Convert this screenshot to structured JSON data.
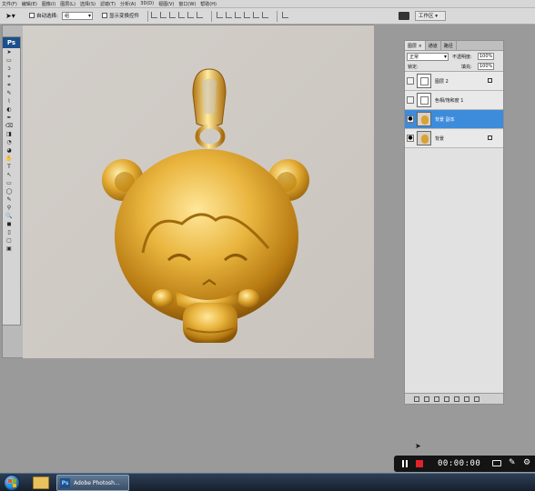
{
  "menubar": {
    "items": [
      "文件(F)",
      "编辑(E)",
      "图像(I)",
      "图层(L)",
      "选择(S)",
      "滤镜(T)",
      "分析(A)",
      "3D(D)",
      "视图(V)",
      "窗口(W)",
      "帮助(H)"
    ]
  },
  "options": {
    "auto_select_label": "自动选择:",
    "auto_select_value": "组",
    "show_transform_label": "显示变换控件",
    "workspace_label": "工作区 ▾"
  },
  "tools": {
    "logo": "Ps"
  },
  "layers": {
    "tabs": [
      "图层 ×",
      "通道",
      "路径"
    ],
    "blend_mode": "正常",
    "opacity_label": "不透明度:",
    "opacity_value": "100%",
    "lock_label": "锁定:",
    "fill_label": "填充:",
    "fill_value": "100%",
    "items": [
      {
        "name": "图层 2",
        "visible": false,
        "locked": true,
        "selected": false,
        "thumb": "layer"
      },
      {
        "name": "色相/饱和度 1",
        "visible": false,
        "locked": false,
        "selected": false,
        "thumb": "adjustment"
      },
      {
        "name": "背景 副本",
        "visible": true,
        "locked": false,
        "selected": true,
        "thumb": "image"
      },
      {
        "name": "背景",
        "visible": true,
        "locked": true,
        "selected": false,
        "thumb": "image"
      }
    ]
  },
  "recorder": {
    "time": "00:00:00"
  },
  "taskbar": {
    "ps_label": "Adobe Photosh..."
  },
  "colors": {
    "selection": "#3d8bdb",
    "gold": "#d8a235",
    "record_stop": "#e0232a"
  }
}
